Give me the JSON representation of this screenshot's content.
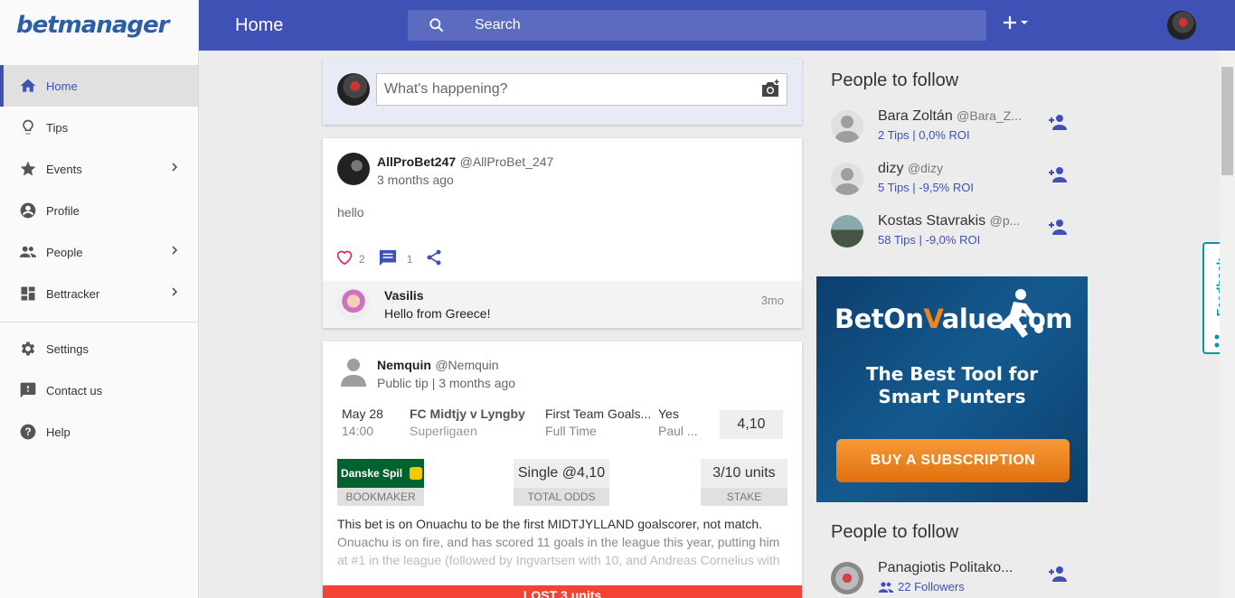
{
  "brand": "betmanager",
  "topbar": {
    "title": "Home",
    "search_placeholder": "Search",
    "plus": "+"
  },
  "sidebar": {
    "items": [
      {
        "label": "Home",
        "icon": "home-icon"
      },
      {
        "label": "Tips",
        "icon": "lightbulb-icon"
      },
      {
        "label": "Events",
        "icon": "star-icon"
      },
      {
        "label": "Profile",
        "icon": "account-icon"
      },
      {
        "label": "People",
        "icon": "people-icon"
      },
      {
        "label": "Bettracker",
        "icon": "dashboard-icon"
      }
    ],
    "secondary": [
      {
        "label": "Settings",
        "icon": "gear-icon"
      },
      {
        "label": "Contact us",
        "icon": "feedback-icon"
      },
      {
        "label": "Help",
        "icon": "help-icon"
      }
    ]
  },
  "compose": {
    "placeholder": "What's happening?"
  },
  "post1": {
    "name": "AllProBet247",
    "handle": "@AllProBet_247",
    "time": "3 months ago",
    "body": "hello",
    "likes": "2",
    "comments": "1",
    "comment": {
      "name": "Vasilis",
      "text": "Hello from Greece!",
      "time": "3mo"
    }
  },
  "post2": {
    "name": "Nemquin",
    "handle": "@Nemquin",
    "meta": "Public tip | 3 months ago",
    "date": "May 28",
    "time": "14:00",
    "match": "FC Midtjy v Lyngby",
    "league": "Superligaen",
    "market": "First Team Goals...",
    "period": "Full Time",
    "selection": "Yes",
    "selection_sub": "Paul ...",
    "odds": "4,10",
    "bookmaker_logo": "Danske Spil",
    "bookmaker_label": "BOOKMAKER",
    "total_odds": "Single @4,10",
    "total_odds_label": "TOTAL ODDS",
    "stake": "3/10 units",
    "stake_label": "STAKE",
    "text1": "This bet is on Onuachu to be the first MIDTJYLLAND goalscorer, not match.",
    "text2": "Onuachu is on fire, and has scored 11 goals in the league this year, putting him",
    "text3": "at #1 in the league (followed by Ingvartsen with 10, and Andreas Cornelius with",
    "result": "LOST 3 units"
  },
  "right": {
    "follow_title": "People to follow",
    "people": [
      {
        "name": "Bara Zoltán",
        "handle": "@Bara_Z...",
        "stats": "2 Tips | 0,0% ROI"
      },
      {
        "name": "dizy",
        "handle": "@dizy",
        "stats": "5 Tips | -9,5% ROI"
      },
      {
        "name": "Kostas Stavrakis",
        "handle": "@p...",
        "stats": "58 Tips | -9,0% ROI"
      }
    ],
    "follow_title2": "People to follow",
    "people2": [
      {
        "name": "Panagiotis Politako...",
        "stats": "22 Followers"
      }
    ]
  },
  "ad": {
    "logo_a": "BetOn",
    "logo_v": "V",
    "logo_b": "alue.com",
    "line1": "The Best Tool for",
    "line2": "Smart Punters",
    "cta": "BUY A SUBSCRIPTION"
  },
  "feedback": "Feedback",
  "colors": {
    "primary": "#3f51b5",
    "lost": "#f44336",
    "accent": "#f58220"
  }
}
